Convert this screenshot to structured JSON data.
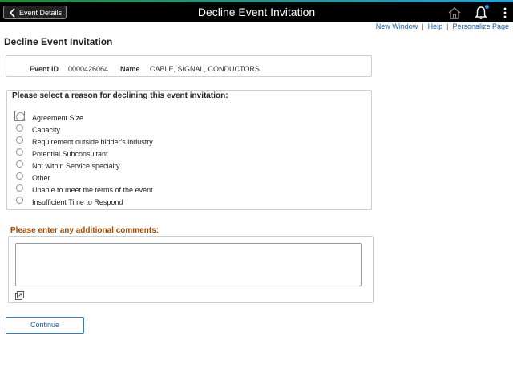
{
  "header": {
    "back_label": "Event Details",
    "title": "Decline Event Invitation",
    "icons": [
      "home-icon",
      "bell-icon",
      "menu-icon"
    ]
  },
  "toplinks": {
    "new_window": "New Window",
    "help": "Help",
    "personalize": "Personalize Page"
  },
  "page": {
    "title": "Decline Event Invitation"
  },
  "event": {
    "id_label": "Event ID",
    "id_value": "0000426064",
    "name_label": "Name",
    "name_value": "CABLE, SIGNAL, CONDUCTORS"
  },
  "reasons": {
    "heading": "Please select a reason for declining this event invitation:",
    "options": [
      "Agreement Size",
      "Capacity",
      "Requirement outside bidder's industry",
      "Potential Subconsultant",
      "Not within Service specialty",
      "Other",
      "Unable to meet the terms of the event",
      "Insufficient Time to Respond"
    ]
  },
  "comments": {
    "label": "Please enter any additional comments:",
    "value": ""
  },
  "actions": {
    "continue_label": "Continue"
  },
  "colors": {
    "header_bg": "#000000",
    "link": "#1a5ea8",
    "comments_label": "#a34a05",
    "accent_green": "#1f8a3a",
    "accent_blue": "#2d9fd8"
  }
}
